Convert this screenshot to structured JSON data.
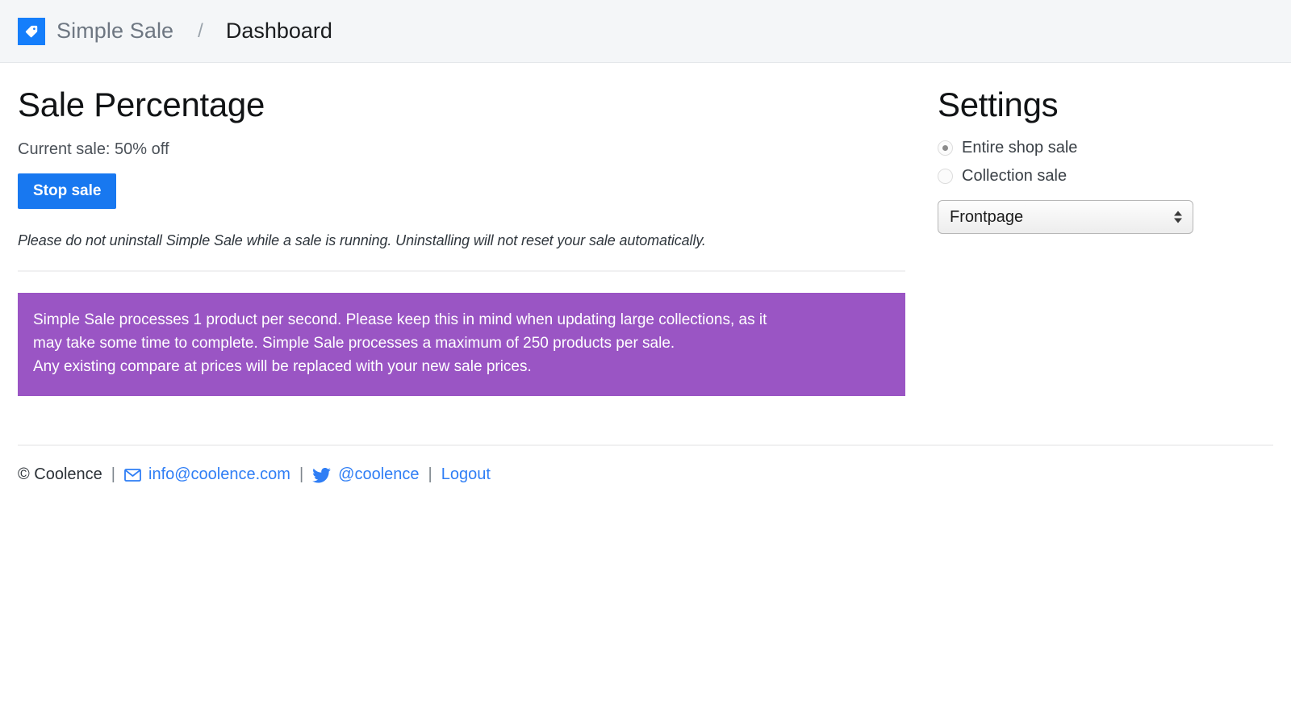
{
  "header": {
    "logo_icon": "price-tag-icon",
    "brand": "Simple Sale",
    "separator": "/",
    "current": "Dashboard",
    "brand_color": "#157efb"
  },
  "main": {
    "title": "Sale Percentage",
    "current_sale": "Current sale: 50% off",
    "stop_button": "Stop sale",
    "button_color": "#1878f0",
    "warning_italic": "Please do not uninstall Simple Sale while a sale is running. Uninstalling will not reset your sale automatically.",
    "notice": {
      "color": "#9a55c4",
      "line1": "Simple Sale processes 1 product per second. Please keep this in mind when updating large collections, as it",
      "line2": "may take some time to complete. Simple Sale processes a maximum of 250 products per sale.",
      "line3": "Any existing compare at prices will be replaced with your new sale prices."
    }
  },
  "settings": {
    "title": "Settings",
    "options": [
      {
        "label": "Entire shop sale",
        "selected": true
      },
      {
        "label": "Collection sale",
        "selected": false
      }
    ],
    "collection_select": {
      "value": "Frontpage",
      "options": [
        "Frontpage"
      ]
    }
  },
  "footer": {
    "copyright": "© Coolence",
    "sep1": "|",
    "sep2": "|",
    "sep3": "|",
    "email_icon": "envelope-icon",
    "email": "info@coolence.com",
    "twitter_icon": "twitter-bird-icon",
    "twitter": "@coolence",
    "logout": "Logout",
    "link_color": "#2f7ef5"
  }
}
